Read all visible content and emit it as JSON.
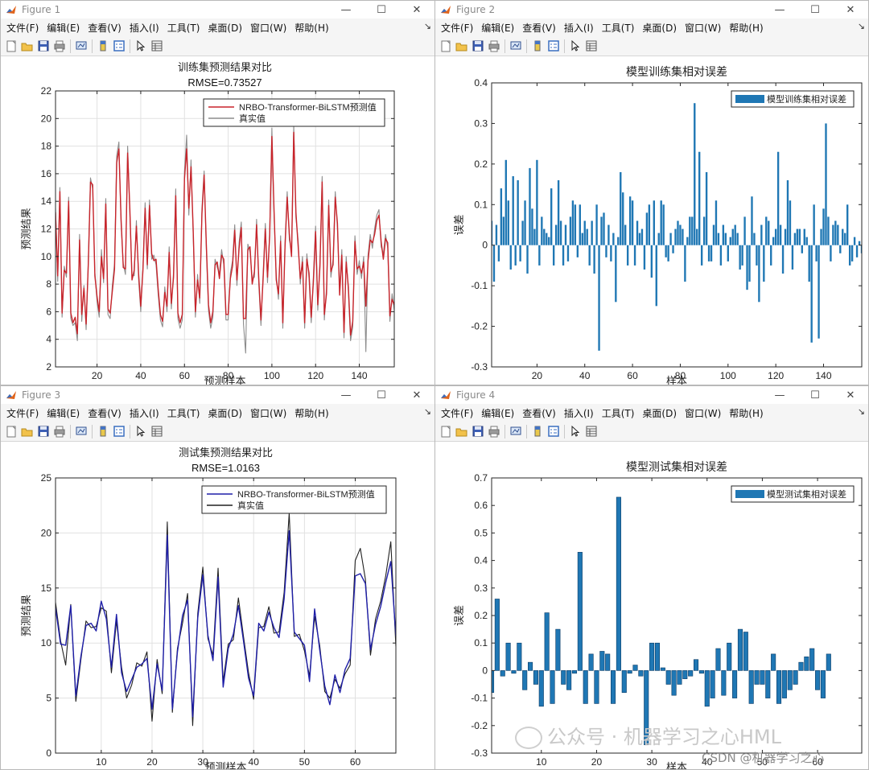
{
  "menu": [
    "文件(F)",
    "编辑(E)",
    "查看(V)",
    "插入(I)",
    "工具(T)",
    "桌面(D)",
    "窗口(W)",
    "帮助(H)"
  ],
  "window_buttons": [
    "—",
    "☐",
    "✕"
  ],
  "dock_symbol": "↘",
  "toolbar_icons": [
    "new-figure-icon",
    "open-file-icon",
    "save-icon",
    "print-icon",
    "sep",
    "link-plot-icon",
    "sep",
    "colorbar-icon",
    "legend-icon",
    "sep",
    "pointer-icon",
    "property-inspector-icon"
  ],
  "colors": {
    "train_pred": "#c8242b",
    "train_true": "#8c8c8c",
    "test_pred": "#1f1fa8",
    "test_true": "#202020",
    "bar": "#1f77b4"
  },
  "windows": [
    {
      "title": "Figure 1"
    },
    {
      "title": "Figure 2"
    },
    {
      "title": "Figure 3"
    },
    {
      "title": "Figure 4"
    }
  ],
  "watermark": "公众号 · 机器学习之心HML",
  "csdn": "CSDN @机器学习之心",
  "chart_data": [
    {
      "type": "line",
      "title": "训练集预测结果对比",
      "subtitle": "RMSE=0.73527",
      "xlabel": "预测样本",
      "ylabel": "预测结果",
      "xlim": [
        1,
        156
      ],
      "ylim": [
        2,
        22
      ],
      "xticks": [
        20,
        40,
        60,
        80,
        100,
        120,
        140
      ],
      "yticks": [
        2,
        4,
        6,
        8,
        10,
        12,
        14,
        16,
        18,
        20,
        22
      ],
      "grid": true,
      "legend_position": "top-right",
      "series": [
        {
          "name": "NRBO-Transformer-BiLSTM预测值",
          "color": "#c8242b",
          "values": [
            13.2,
            8.6,
            14.7,
            5.9,
            9.0,
            8.8,
            14.0,
            5.9,
            5.2,
            5.6,
            4.4,
            11.2,
            5.8,
            7.7,
            5.1,
            9.4,
            15.4,
            15.2,
            8.6,
            7.1,
            6.0,
            10.0,
            8.4,
            13.8,
            6.2,
            5.9,
            7.5,
            9.1,
            16.8,
            17.8,
            12.7,
            9.2,
            9.1,
            17.5,
            13.5,
            8.3,
            9.0,
            12.2,
            8.8,
            6.4,
            9.0,
            13.5,
            9.4,
            13.7,
            10.2,
            9.7,
            9.8,
            7.6,
            5.8,
            5.3,
            7.4,
            6.4,
            10.3,
            6.6,
            8.5,
            14.4,
            5.9,
            5.2,
            5.8,
            15.6,
            17.8,
            13.5,
            16.5,
            11.9,
            6.0,
            8.3,
            7.0,
            13.1,
            15.9,
            10.9,
            6.5,
            5.2,
            6.0,
            9.4,
            9.6,
            8.4,
            10.1,
            9.8,
            5.8,
            5.8,
            8.4,
            9.3,
            11.9,
            8.3,
            10.6,
            12.1,
            5.5,
            5.5,
            10.5,
            10.7,
            8.0,
            8.9,
            12.3,
            8.4,
            5.4,
            8.4,
            12.0,
            8.5,
            11.5,
            18.7,
            13.3,
            8.3,
            7.3,
            11.1,
            5.2,
            10.6,
            14.3,
            11.6,
            10.0,
            19.0,
            13.2,
            10.8,
            8.4,
            9.6,
            5.2,
            9.8,
            8.8,
            5.6,
            8.2,
            11.8,
            6.5,
            9.3,
            15.4,
            5.8,
            7.3,
            13.7,
            8.9,
            9.4,
            14.3,
            12.4,
            7.2,
            10.1,
            4.5,
            9.6,
            7.8,
            4.3,
            5.3,
            11.1,
            9.1,
            9.3,
            8.8,
            9.6,
            6.4,
            9.7,
            11.2,
            11.0,
            11.6,
            12.6,
            13.0,
            11.1,
            9.8,
            11.3,
            11.0,
            5.7,
            6.9,
            6.5
          ]
        },
        {
          "name": "真实值",
          "color": "#8c8c8c",
          "values": [
            13.5,
            8.2,
            15.0,
            5.6,
            9.3,
            8.5,
            14.3,
            5.5,
            5.0,
            5.2,
            3.9,
            11.6,
            5.3,
            7.9,
            4.7,
            9.8,
            15.7,
            14.9,
            8.9,
            6.7,
            5.6,
            10.5,
            8.1,
            14.2,
            5.8,
            5.5,
            7.9,
            9.5,
            17.3,
            18.3,
            12.3,
            9.5,
            8.7,
            18.0,
            13.1,
            8.7,
            8.6,
            12.6,
            8.4,
            6.0,
            9.3,
            13.9,
            9.1,
            14.1,
            9.8,
            10.1,
            9.4,
            7.2,
            5.4,
            4.9,
            7.8,
            6.0,
            10.7,
            6.2,
            8.9,
            14.9,
            5.5,
            4.8,
            5.4,
            16.1,
            18.8,
            13.0,
            17.0,
            11.5,
            5.6,
            8.7,
            6.6,
            13.5,
            16.2,
            10.5,
            6.1,
            4.8,
            5.6,
            9.8,
            9.2,
            8.8,
            10.5,
            9.4,
            5.4,
            5.4,
            8.8,
            9.7,
            12.3,
            7.9,
            11.0,
            12.5,
            5.1,
            3.0,
            10.9,
            10.3,
            8.4,
            8.5,
            12.7,
            8.0,
            5.0,
            8.8,
            12.4,
            8.1,
            11.9,
            19.3,
            12.9,
            8.7,
            6.9,
            11.5,
            4.8,
            11.0,
            14.7,
            11.2,
            10.4,
            19.5,
            12.8,
            11.2,
            8.0,
            10.0,
            4.8,
            10.2,
            8.4,
            5.2,
            8.6,
            12.2,
            6.1,
            9.7,
            15.8,
            5.4,
            7.7,
            14.1,
            8.5,
            9.8,
            14.7,
            12.0,
            7.6,
            10.5,
            4.1,
            10.0,
            7.4,
            3.9,
            4.9,
            11.5,
            8.7,
            9.7,
            8.4,
            10.0,
            3.1,
            10.1,
            11.6,
            10.6,
            12.0,
            13.0,
            13.4,
            10.7,
            10.2,
            11.6,
            10.6,
            5.3,
            7.3,
            6.1
          ]
        }
      ]
    },
    {
      "type": "bar",
      "title": "模型训练集相对误差",
      "xlabel": "样本",
      "ylabel": "误差",
      "xlim": [
        1,
        156
      ],
      "ylim": [
        -0.3,
        0.4
      ],
      "xticks": [
        20,
        40,
        60,
        80,
        100,
        120,
        140
      ],
      "yticks": [
        -0.3,
        -0.2,
        -0.1,
        0,
        0.1,
        0.2,
        0.3,
        0.4
      ],
      "grid": false,
      "legend_position": "top-right",
      "series": [
        {
          "name": "模型训练集相对误差",
          "color": "#1f77b4",
          "values": [
            0.06,
            -0.09,
            0.05,
            -0.04,
            0.14,
            0.07,
            0.21,
            0.11,
            -0.06,
            0.17,
            -0.05,
            0.16,
            -0.04,
            0.06,
            0.11,
            -0.07,
            0.19,
            0.09,
            0.04,
            0.21,
            -0.05,
            0.07,
            0.04,
            0.03,
            0.02,
            0.14,
            -0.05,
            0.05,
            0.16,
            0.06,
            -0.05,
            0.05,
            -0.04,
            0.07,
            0.11,
            0.1,
            -0.03,
            0.1,
            0.03,
            0.06,
            0.04,
            -0.05,
            0.06,
            -0.07,
            0.1,
            -0.26,
            0.07,
            0.08,
            -0.03,
            0.05,
            -0.04,
            0.03,
            -0.14,
            0.02,
            0.18,
            0.13,
            0.05,
            -0.05,
            0.12,
            0.11,
            -0.05,
            0.06,
            0.03,
            0.04,
            -0.06,
            0.08,
            0.1,
            -0.08,
            0.11,
            -0.15,
            0.03,
            0.11,
            0.1,
            -0.03,
            -0.04,
            0.03,
            -0.02,
            0.04,
            0.06,
            0.05,
            0.04,
            -0.09,
            0.02,
            0.07,
            0.07,
            0.35,
            0.04,
            0.23,
            -0.05,
            0.07,
            0.18,
            -0.04,
            -0.04,
            0.05,
            0.11,
            0.03,
            -0.05,
            0.05,
            0.03,
            -0.04,
            0.02,
            0.04,
            0.05,
            0.03,
            -0.06,
            -0.05,
            0.07,
            -0.11,
            -0.09,
            0.12,
            0.03,
            -0.05,
            -0.14,
            0.05,
            -0.09,
            0.07,
            0.06,
            -0.05,
            0.02,
            0.04,
            0.23,
            0.05,
            -0.07,
            0.04,
            0.16,
            0.11,
            -0.06,
            0.03,
            0.04,
            0.04,
            -0.02,
            0.04,
            0.02,
            -0.09,
            -0.24,
            0.1,
            -0.04,
            -0.23,
            0.04,
            0.09,
            0.3,
            0.07,
            -0.04,
            0.05,
            0.06,
            0.05,
            -0.02,
            0.04,
            0.03,
            0.1,
            -0.05,
            -0.04,
            0.02,
            -0.03,
            0.01,
            -0.02
          ]
        }
      ]
    },
    {
      "type": "line",
      "title": "测试集预测结果对比",
      "subtitle": "RMSE=1.0163",
      "xlabel": "预测样本",
      "ylabel": "预测结果",
      "xlim": [
        1,
        68
      ],
      "ylim": [
        0,
        25
      ],
      "xticks": [
        10,
        20,
        30,
        40,
        50,
        60
      ],
      "yticks": [
        0,
        5,
        10,
        15,
        20,
        25
      ],
      "grid": true,
      "legend_position": "top-right",
      "series": [
        {
          "name": "NRBO-Transformer-BiLSTM预测值",
          "color": "#1f1fa8",
          "values": [
            13.2,
            9.9,
            9.8,
            13.4,
            5.2,
            8.8,
            11.6,
            11.8,
            11.1,
            13.8,
            12.2,
            7.8,
            12.6,
            7.3,
            5.6,
            6.7,
            7.8,
            8.1,
            8.6,
            4.0,
            8.1,
            5.7,
            19.8,
            4.0,
            9.2,
            12.5,
            13.9,
            3.3,
            12.3,
            16.2,
            10.7,
            8.4,
            16.0,
            6.0,
            9.5,
            10.8,
            13.4,
            10.2,
            6.8,
            5.2,
            11.8,
            11.1,
            12.8,
            11.4,
            10.5,
            14.0,
            20.2,
            11.0,
            10.4,
            9.8,
            6.5,
            13.1,
            9.4,
            6.1,
            4.4,
            7.1,
            5.5,
            7.6,
            8.6,
            16.1,
            16.3,
            15.4,
            9.4,
            11.7,
            13.3,
            15.5,
            17.4,
            10.6
          ]
        },
        {
          "name": "真实值",
          "color": "#202020",
          "values": [
            13.7,
            10.2,
            8.0,
            13.5,
            4.7,
            8.5,
            12.0,
            11.4,
            11.5,
            13.2,
            12.9,
            7.3,
            12.0,
            7.8,
            5.0,
            6.2,
            8.2,
            7.9,
            9.2,
            2.9,
            8.5,
            5.4,
            21.0,
            3.7,
            9.5,
            11.8,
            14.5,
            2.5,
            12.7,
            16.9,
            10.4,
            8.9,
            16.8,
            6.5,
            9.9,
            10.3,
            14.1,
            10.6,
            7.3,
            4.9,
            11.4,
            11.5,
            13.3,
            10.9,
            11.0,
            14.6,
            21.8,
            10.6,
            10.8,
            9.3,
            7.0,
            12.4,
            9.8,
            5.6,
            5.0,
            6.7,
            5.9,
            7.2,
            8.0,
            17.5,
            18.6,
            15.8,
            8.9,
            12.2,
            13.8,
            16.1,
            19.2,
            9.7
          ]
        }
      ]
    },
    {
      "type": "bar",
      "title": "模型测试集相对误差",
      "xlabel": "样本",
      "ylabel": "误差",
      "xlim": [
        1,
        68
      ],
      "ylim": [
        -0.3,
        0.7
      ],
      "xticks": [
        10,
        20,
        30,
        40,
        50,
        60
      ],
      "yticks": [
        -0.3,
        -0.2,
        -0.1,
        0,
        0.1,
        0.2,
        0.3,
        0.4,
        0.5,
        0.6,
        0.7
      ],
      "grid": false,
      "legend_position": "top-right",
      "series": [
        {
          "name": "模型测试集相对误差",
          "color": "#1f77b4",
          "values": [
            -0.08,
            0.26,
            -0.02,
            0.1,
            -0.01,
            0.1,
            -0.07,
            0.03,
            -0.05,
            -0.13,
            0.21,
            -0.12,
            0.15,
            -0.05,
            -0.07,
            -0.01,
            0.43,
            -0.12,
            0.06,
            -0.12,
            0.07,
            0.06,
            -0.12,
            0.63,
            -0.08,
            -0.01,
            0.02,
            -0.02,
            -0.27,
            0.1,
            0.1,
            0.01,
            -0.05,
            -0.09,
            -0.05,
            -0.03,
            -0.02,
            0.04,
            -0.01,
            -0.13,
            -0.1,
            0.08,
            -0.09,
            0.1,
            -0.1,
            0.15,
            0.14,
            -0.12,
            -0.05,
            -0.05,
            -0.1,
            0.06,
            -0.12,
            -0.1,
            -0.07,
            -0.05,
            0.03,
            0.05,
            0.08,
            -0.07,
            -0.1,
            0.06
          ]
        }
      ]
    }
  ]
}
